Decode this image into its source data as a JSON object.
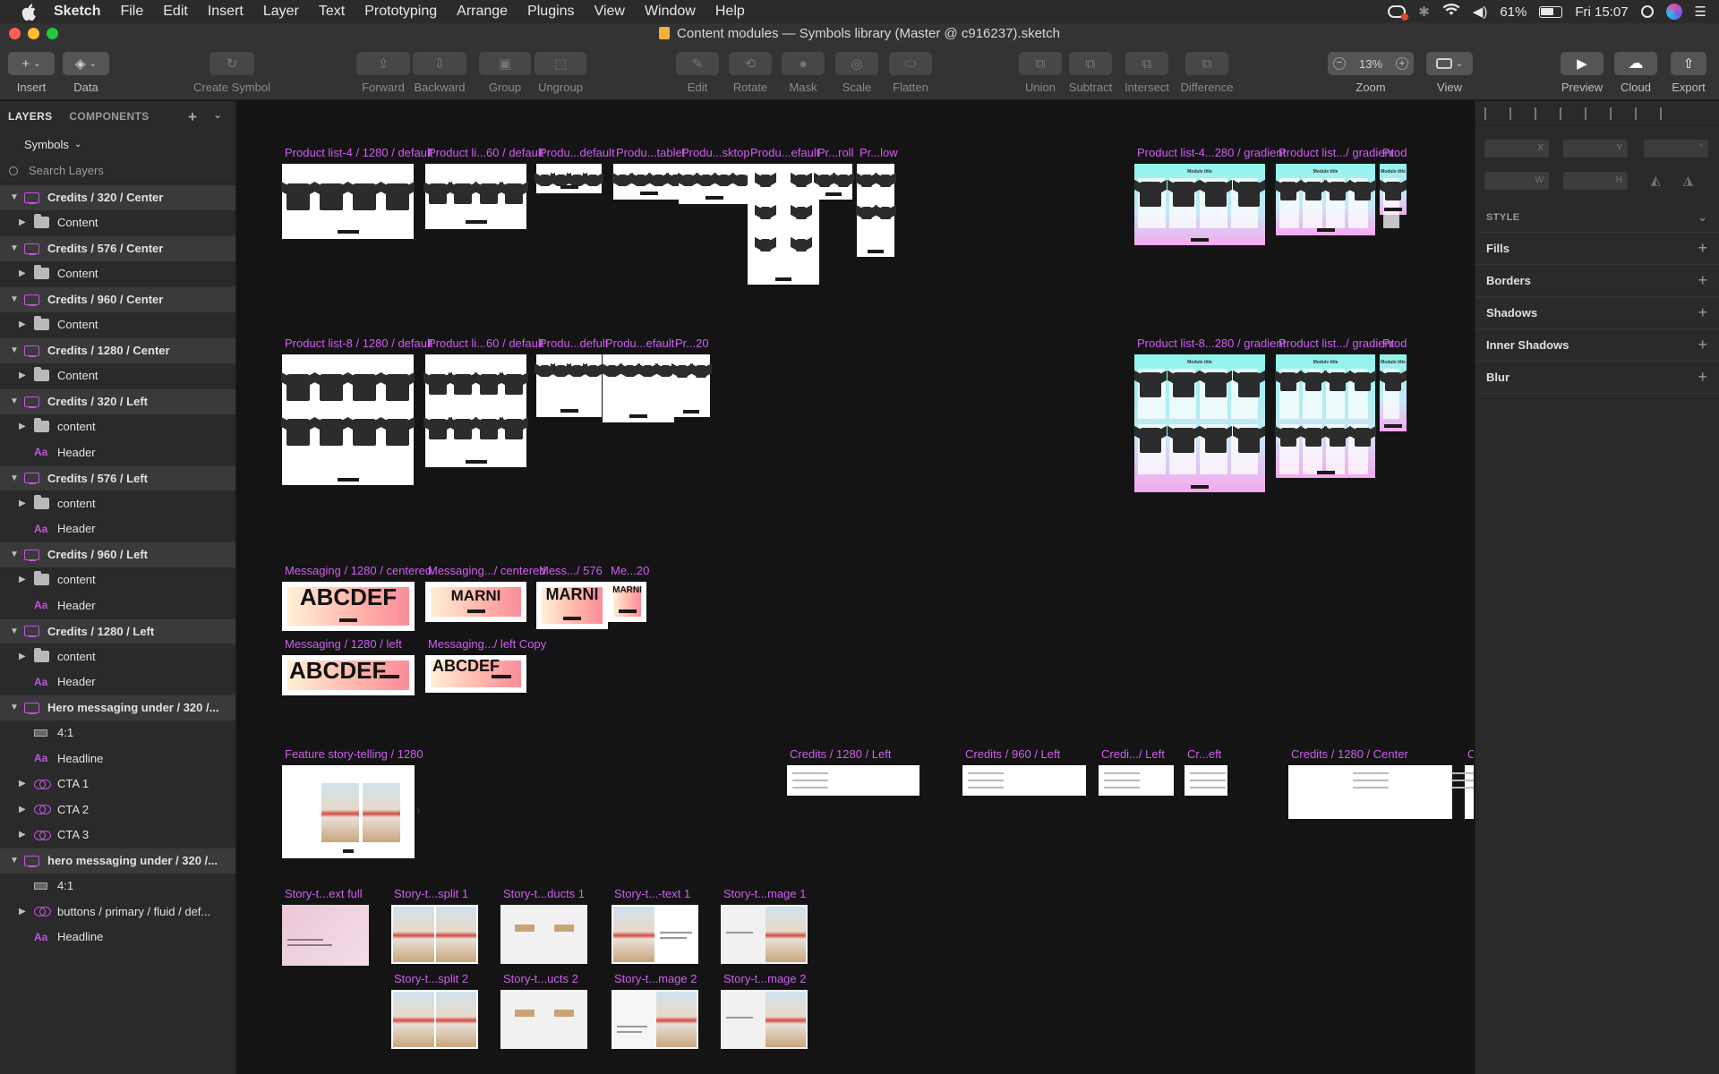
{
  "menubar": {
    "app_name": "Sketch",
    "items": [
      "File",
      "Edit",
      "Insert",
      "Layer",
      "Text",
      "Prototyping",
      "Arrange",
      "Plugins",
      "View",
      "Window",
      "Help"
    ],
    "battery": "61%",
    "clock": "Fri 15:07"
  },
  "window": {
    "title": "Content modules — Symbols library (Master @ c916237).sketch",
    "traffic_colors": [
      "#fe5f57",
      "#febc2e",
      "#28c840"
    ]
  },
  "toolbar": {
    "insert": "Insert",
    "data": "Data",
    "create_symbol": "Create Symbol",
    "forward": "Forward",
    "backward": "Backward",
    "group": "Group",
    "ungroup": "Ungroup",
    "edit": "Edit",
    "rotate": "Rotate",
    "mask": "Mask",
    "scale": "Scale",
    "flatten": "Flatten",
    "union": "Union",
    "subtract": "Subtract",
    "intersect": "Intersect",
    "difference": "Difference",
    "zoom_value": "13%",
    "zoom": "Zoom",
    "view": "View",
    "preview": "Preview",
    "cloud": "Cloud",
    "export": "Export"
  },
  "layers_panel": {
    "tab_layers": "LAYERS",
    "tab_components": "COMPONENTS",
    "page": "Symbols",
    "search_placeholder": "Search Layers",
    "items": [
      {
        "kind": "group",
        "text": "Credits / 320 / Center",
        "icon": "artboard-icon"
      },
      {
        "kind": "child",
        "text": "Content",
        "icon": "folder-icon",
        "arrow": true
      },
      {
        "kind": "group",
        "text": "Credits / 576 / Center",
        "icon": "artboard-icon"
      },
      {
        "kind": "child",
        "text": "Content",
        "icon": "folder-icon",
        "arrow": true
      },
      {
        "kind": "group",
        "text": "Credits / 960 / Center",
        "icon": "artboard-icon"
      },
      {
        "kind": "child",
        "text": "Content",
        "icon": "folder-icon",
        "arrow": true
      },
      {
        "kind": "group",
        "text": "Credits / 1280 / Center",
        "icon": "artboard-icon"
      },
      {
        "kind": "child",
        "text": "Content",
        "icon": "folder-icon",
        "arrow": true
      },
      {
        "kind": "group",
        "text": "Credits / 320 / Left",
        "icon": "artboard-icon"
      },
      {
        "kind": "child",
        "text": "content",
        "icon": "folder-icon",
        "arrow": true
      },
      {
        "kind": "child",
        "text": "Header",
        "icon": "text-icon",
        "arrow": false
      },
      {
        "kind": "group",
        "text": "Credits / 576 / Left",
        "icon": "artboard-icon"
      },
      {
        "kind": "child",
        "text": "content",
        "icon": "folder-icon",
        "arrow": true
      },
      {
        "kind": "child",
        "text": "Header",
        "icon": "text-icon",
        "arrow": false
      },
      {
        "kind": "group",
        "text": "Credits / 960 / Left",
        "icon": "artboard-icon"
      },
      {
        "kind": "child",
        "text": "content",
        "icon": "folder-icon",
        "arrow": true
      },
      {
        "kind": "child",
        "text": "Header",
        "icon": "text-icon",
        "arrow": false
      },
      {
        "kind": "group",
        "text": "Credits / 1280 / Left",
        "icon": "artboard-icon"
      },
      {
        "kind": "child",
        "text": "content",
        "icon": "folder-icon",
        "arrow": true
      },
      {
        "kind": "child",
        "text": "Header",
        "icon": "text-icon",
        "arrow": false
      },
      {
        "kind": "group",
        "text": "Hero messaging under / 320 /...",
        "icon": "artboard-icon"
      },
      {
        "kind": "child",
        "text": "4:1",
        "icon": "rectangle-icon",
        "arrow": false
      },
      {
        "kind": "child",
        "text": "Headline",
        "icon": "text-icon",
        "arrow": false
      },
      {
        "kind": "child",
        "text": "CTA 1",
        "icon": "symbol-icon",
        "arrow": true
      },
      {
        "kind": "child",
        "text": "CTA 2",
        "icon": "symbol-icon",
        "arrow": true
      },
      {
        "kind": "child",
        "text": "CTA 3",
        "icon": "symbol-icon",
        "arrow": true
      },
      {
        "kind": "group",
        "text": "hero messaging under / 320 /...",
        "icon": "artboard-icon"
      },
      {
        "kind": "child",
        "text": "4:1",
        "icon": "rectangle-icon",
        "arrow": false
      },
      {
        "kind": "child",
        "text": "buttons / primary / fluid / def...",
        "icon": "symbol-icon",
        "arrow": true
      },
      {
        "kind": "child",
        "text": "Headline",
        "icon": "text-icon",
        "arrow": false
      }
    ]
  },
  "artboards": [
    "Product list-4 / 1280 / default",
    "Product li...60 / default",
    "Produ...default",
    "Produ...tablet",
    "Produ...sktop",
    "Produ...efault",
    "Pr...roll",
    "Pr...low",
    "Product list-4...280 / gradient",
    "Product list.../ gradient",
    "Prod",
    "Product list-8 / 1280 / default",
    "Product li...60 / default",
    "Produ...defult",
    "Produ...efault",
    "Pr...20",
    "Product list-8...280 / gradient",
    "Product list.../ gradient",
    "Prod",
    "Messaging / 1280 / centered",
    "Messaging.../ centered",
    "Mess.../ 576",
    "Me...20",
    "Messaging / 1280 / left",
    "Messaging.../ left Copy",
    "Feature story-telling / 1280",
    "Credits / 1280 / Left",
    "Credits / 960 / Left",
    "Credi.../ Left",
    "Cr...eft",
    "Credits / 1280 / Center",
    "C",
    "Story-t...ext full",
    "Story-t...split 1",
    "Story-t...ducts 1",
    "Story-t...-text 1",
    "Story-t...mage 1",
    "Story-t...split 2",
    "Story-t...ucts 2",
    "Story-t...mage 2",
    "Story-t...mage 2"
  ],
  "artboard_text": {
    "abcdef": "ABCDEF",
    "marni": "MARNI",
    "module_title": "Module title"
  },
  "inspector": {
    "x": "X",
    "y": "Y",
    "rot": "°",
    "w": "W",
    "h": "H",
    "style": "STYLE",
    "fills": "Fills",
    "borders": "Borders",
    "shadows": "Shadows",
    "inner_shadows": "Inner Shadows",
    "blur": "Blur"
  }
}
